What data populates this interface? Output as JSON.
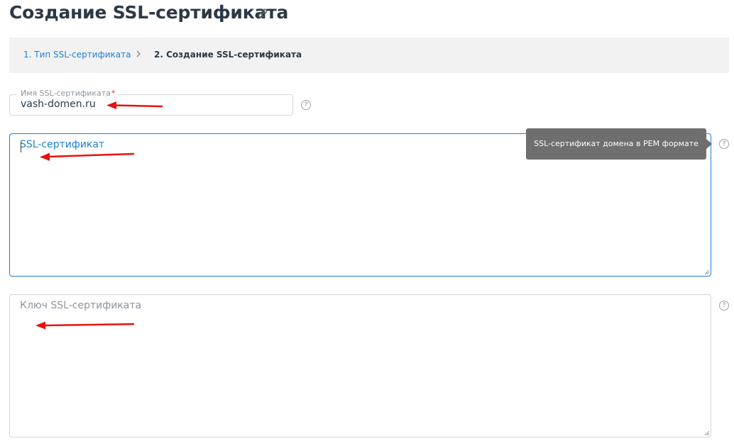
{
  "page": {
    "title": "Создание SSL-сертификата",
    "title_link_icon": "link-icon"
  },
  "steps": {
    "step1_label": "1. Тип SSL-сертификата",
    "separator_icon": "chevron-right-icon",
    "step2_label": "2. Создание SSL-сертификата"
  },
  "form": {
    "name_field": {
      "label": "Имя SSL-сертификата",
      "required_mark": "*",
      "value": "vash-domen.ru",
      "help_icon": "question-circle-icon"
    },
    "certificate_field": {
      "label": "SSL-сертификат",
      "value": "",
      "help_icon": "question-circle-icon",
      "tooltip": "SSL-сертификат домена в PEM формате"
    },
    "key_field": {
      "label": "Ключ SSL-сертификата",
      "value": "",
      "help_icon": "question-circle-icon"
    },
    "help_glyph": "?"
  },
  "annotations": {
    "arrow_color": "#e8110f",
    "arrow_icon": "red-arrow-icon"
  },
  "colors": {
    "accent": "#1f7fd1",
    "text": "#2b3946",
    "required": "#d9363e",
    "tooltip_bg": "#6f6f6f"
  }
}
